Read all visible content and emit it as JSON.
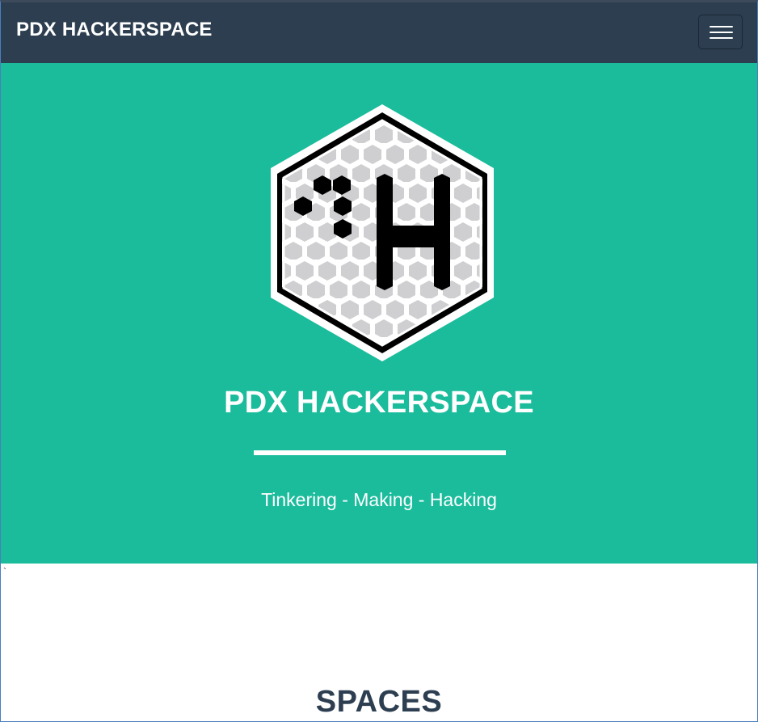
{
  "navbar": {
    "brand": "PDX HACKERSPACE",
    "menu_icon": "hamburger-icon"
  },
  "masthead": {
    "logo_icon": "hexagon-h-logo",
    "title": "PDX HACKERSPACE",
    "tagline": "Tinkering - Making - Hacking"
  },
  "stray_text": "`",
  "sections": {
    "spaces_title": "SPACES"
  },
  "colors": {
    "navbar": "#2c3e50",
    "masthead": "#1abc9c",
    "heading": "#2c3e50"
  }
}
